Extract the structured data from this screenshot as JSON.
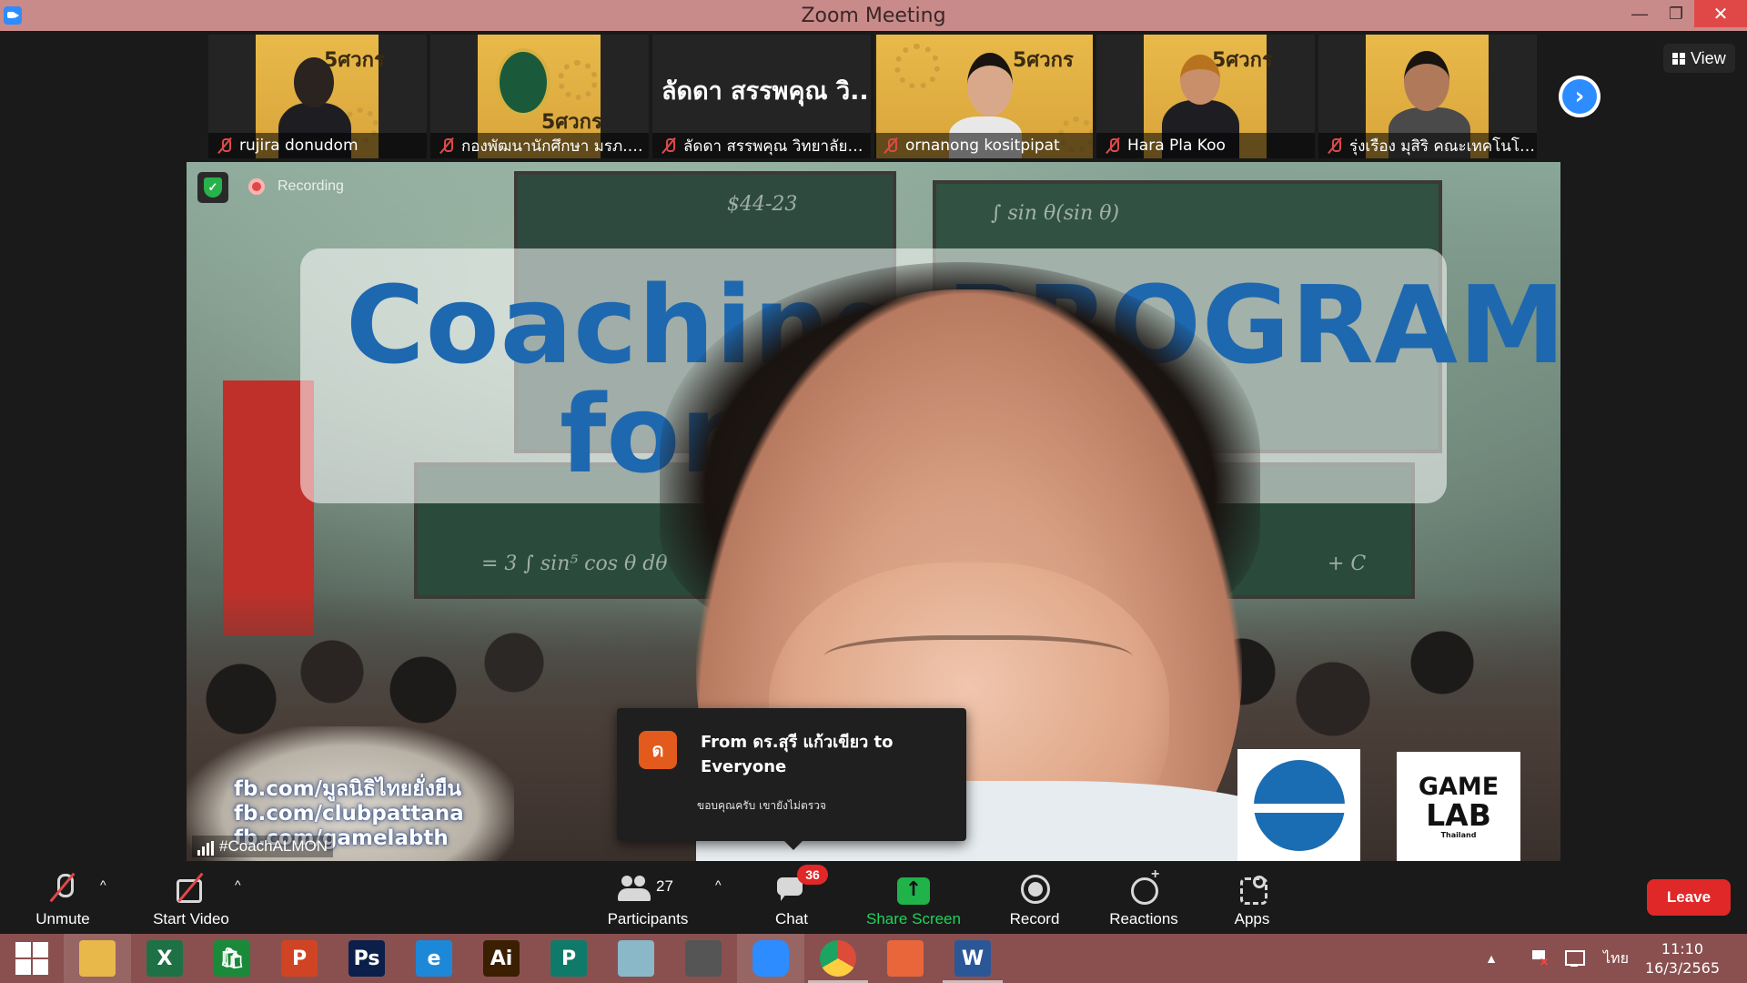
{
  "window": {
    "title": "Zoom Meeting",
    "minimize_label": "—",
    "restore_label": "❐",
    "close_label": "✕"
  },
  "gallery": {
    "participants": [
      {
        "name": "rujira donudom",
        "has_video": true
      },
      {
        "name": "กองพัฒนานักศึกษา มรภ.พร...",
        "has_video": true
      },
      {
        "name": "ลัดดา สรรพคุณ วิทยาลัยกา...",
        "has_video": false,
        "display_name": "ลัดดา สรรพคุณ วิ..."
      },
      {
        "name": "ornanong kositpipat",
        "has_video": true
      },
      {
        "name": "Hara Pla Koo",
        "has_video": true
      },
      {
        "name": "รุ่งเรือง มุสิริ คณะเทคโนโลยีอุ...",
        "has_video": true
      }
    ],
    "tile_badge_text": "5ศวกร",
    "next_icon": "chevron-right-icon",
    "next_glyph": "›",
    "view_label": "View"
  },
  "main_video": {
    "recording_label": "Recording",
    "speaker_name": "#CoachALMON",
    "banner_line1": "Coaching PROGRAM",
    "banner_line2": "for          er",
    "fb_links": [
      "fb.com/มูลนิธิไทยยั่งยืน",
      "fb.com/clubpattana",
      "fb.com/gamelabth"
    ],
    "chalk_text": [
      "$44-23",
      "∫ sin θ(sin θ)",
      "= 3 ∫ sin⁵ cos θ dθ",
      "+ C"
    ],
    "logo_game": {
      "line1": "GAME",
      "line2": "LAB",
      "line3": "Thailand"
    }
  },
  "chat_popup": {
    "avatar_letter": "ด",
    "from_text": "From ดร.สุรี  แก้วเขียว to Everyone",
    "message": "ขอบคุณครับ เขายังไม่ตรวจ"
  },
  "toolbar": {
    "unmute_label": "Unmute",
    "start_video_label": "Start Video",
    "participants_label": "Participants",
    "participants_count": "27",
    "chat_label": "Chat",
    "chat_badge": "36",
    "share_label": "Share Screen",
    "record_label": "Record",
    "reactions_label": "Reactions",
    "apps_label": "Apps",
    "leave_label": "Leave",
    "caret": "^"
  },
  "taskbar": {
    "apps": [
      {
        "name": "file-explorer",
        "glyph": "",
        "color": "#e8b84a",
        "active": true
      },
      {
        "name": "excel",
        "glyph": "X",
        "color": "#1e7145"
      },
      {
        "name": "store",
        "glyph": "🛍",
        "color": "#1a8a3a"
      },
      {
        "name": "powerpoint",
        "glyph": "P",
        "color": "#d04423"
      },
      {
        "name": "photoshop",
        "glyph": "Ps",
        "color": "#0b1f4a"
      },
      {
        "name": "internet-explorer",
        "glyph": "e",
        "color": "#1e88d8"
      },
      {
        "name": "illustrator",
        "glyph": "Ai",
        "color": "#3a1f00"
      },
      {
        "name": "publisher",
        "glyph": "P",
        "color": "#0f7a6a"
      },
      {
        "name": "unknown-app",
        "glyph": "",
        "color": "#8ab8c8"
      },
      {
        "name": "photoscape",
        "glyph": "",
        "color": "#555555"
      },
      {
        "name": "zoom",
        "glyph": "",
        "color": "#2d8cff",
        "active": true
      },
      {
        "name": "chrome",
        "glyph": "",
        "color": "#dd4b39",
        "pinned_open": true
      },
      {
        "name": "office",
        "glyph": "",
        "color": "#e8663a"
      },
      {
        "name": "word",
        "glyph": "W",
        "color": "#2b5797",
        "pinned_open": true
      }
    ],
    "tray_up": "▲",
    "language": "ไทย",
    "time": "11:10",
    "date": "16/3/2565"
  }
}
